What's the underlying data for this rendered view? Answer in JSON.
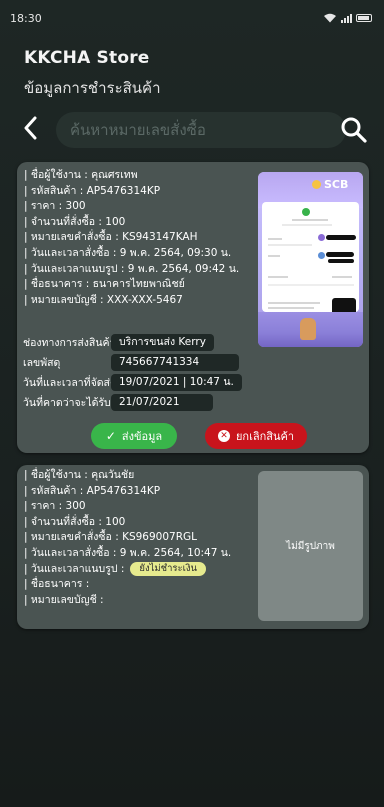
{
  "status_bar": {
    "time": "18:30"
  },
  "header": {
    "store_name": "KKCHA Store",
    "page_title": "ข้อมูลการชำระสินค้า"
  },
  "search": {
    "placeholder": "ค้นหาหมายเลขสั่งซื้อ",
    "value": ""
  },
  "orders": [
    {
      "lines": [
        "| ชื่อผู้ใช้งาน : คุณศรเทพ",
        "| รหัสสินค้า : AP5476314KP",
        "| ราคา : 300",
        "| จำนวนที่สั่งซื้อ : 100",
        "| หมายเลขคำสั่งซื้อ : KS943147KAH",
        "| วันและเวลาสั่งซื้อ : 9 พ.ค. 2564, 09:30 น.",
        "| วันและเวลาแนบรูป : 9 พ.ค. 2564, 09:42 น.",
        "| ชื่อธนาคาร : ธนาคารไทยพาณิชย์",
        "| หมายเลขบัญชี : XXX-XXX-5467"
      ],
      "slip_bank": "SCB",
      "shipping": {
        "carrier_label": "ช่องทางการส่งสินค้า",
        "carrier_value": "บริการขนส่ง Kerry",
        "tracking_label": "เลขพัสดุ",
        "tracking_value": "745667741334",
        "shipped_label": "วันที่และเวลาที่จัดส่ง",
        "shipped_value": "19/07/2021 | 10:47 น.",
        "eta_label": "วันที่คาดว่าจะได้รับ",
        "eta_value": "21/07/2021"
      },
      "actions": {
        "confirm_label": "ส่งข้อมูล",
        "cancel_label": "ยกเลิกสินค้า"
      }
    },
    {
      "lines": [
        "| ชื่อผู้ใช้งาน : คุณวันชัย",
        "| รหัสสินค้า : AP5476314KP",
        "| ราคา : 300",
        "| จำนวนที่สั่งซื้อ : 100",
        "| หมายเลขคำสั่งซื้อ : KS969007RGL",
        "| วันและเวลาสั่งซื้อ : 9 พ.ค. 2564, 10:47 น."
      ],
      "attach_label": "| วันและเวลาแนบรูป :",
      "unpaid_badge": "ยังไม่ชำระเงิน",
      "bank_line": "| ชื่อธนาคาร :",
      "account_line": "| หมายเลขบัญชี :",
      "no_image_text": "ไม่มีรูปภาพ"
    }
  ],
  "colors": {
    "background": "#1d2423",
    "card": "#4a5452",
    "confirm": "#39b54a",
    "cancel": "#c8141c",
    "unpaid_badge": "#e6ea8e"
  }
}
